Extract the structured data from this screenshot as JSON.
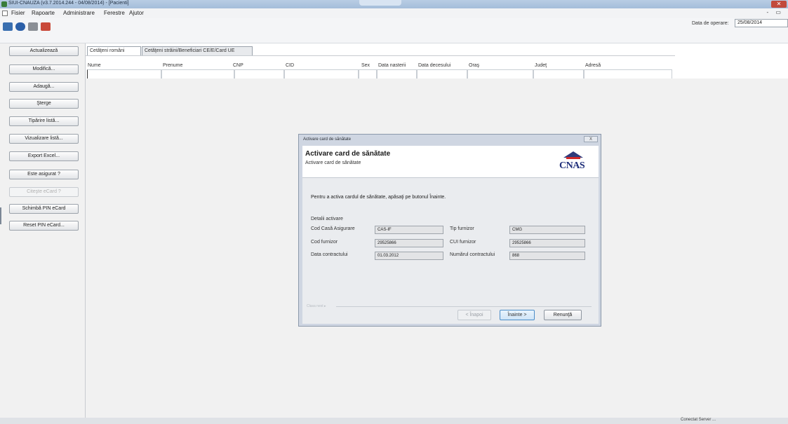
{
  "window": {
    "title": "SIUI-CNAUZA (v3.7.2014.244 - 04/08/2014) - [Pacienti]"
  },
  "menu": {
    "items": [
      "Fisier",
      "Rapoarte",
      "Administrare",
      "Ferestre",
      "Ajutor"
    ],
    "window_controls": "- ▭"
  },
  "toolbar": {
    "icons": [
      "people-icon",
      "card-icon",
      "printer-icon",
      "document-icon"
    ],
    "op_date_label": "Data de operare:",
    "op_date_value": "25/08/2014"
  },
  "sidebar": {
    "buttons": [
      {
        "label": "Actualizează",
        "enabled": true
      },
      {
        "label": "Modifică...",
        "enabled": true
      },
      {
        "label": "Adaugă...",
        "enabled": true
      },
      {
        "label": "Şterge",
        "enabled": true
      },
      {
        "label": "Tipărire listă...",
        "enabled": true
      },
      {
        "label": "Vizualizare listă...",
        "enabled": true
      },
      {
        "label": "Export Excel...",
        "enabled": true
      },
      {
        "label": "Este asigurat ?",
        "enabled": true
      },
      {
        "label": "Citeşte eCard ?",
        "enabled": false
      },
      {
        "label": "Schimbă PIN eCard",
        "enabled": true
      },
      {
        "label": "Reset PIN eCard...",
        "enabled": true
      }
    ]
  },
  "tabs": [
    {
      "label": "Cetăţeni români",
      "active": true
    },
    {
      "label": "Cetăţeni străini/Beneficiari CE/E/Card UE",
      "active": false
    }
  ],
  "grid": {
    "columns": [
      "Nume",
      "Prenume",
      "CNP",
      "CID",
      "Sex",
      "Data nasterii",
      "Data decesului",
      "Oraş",
      "Judeţ",
      "Adresă"
    ]
  },
  "status": {
    "text": "Conectat  Server  ..."
  },
  "dialog": {
    "window_title": "Activare card de sănătate",
    "close_label": "X",
    "header_title": "Activare card de sănătate",
    "header_subtitle": "Activare card de sănătate",
    "logo_text": "CNAS",
    "intro": "Pentru a activa cardul de sănătate, apăsaţi pe butonul Înainte.",
    "section_title": "Detalii activare",
    "fields": {
      "casa_label": "Cod Casă Asigurare",
      "casa_value": "CAS-IF",
      "tip_label": "Tip furnizor",
      "tip_value": "CMG",
      "cod_label": "Cod furnizor",
      "cod_value": "29525866",
      "cui_label": "CUI furnizor",
      "cui_value": "29525866",
      "data_label": "Data contractului",
      "data_value": "01.03.2012",
      "numar_label": "Numărul contractului",
      "numar_value": "868"
    },
    "step_label": "Clasa next ▸",
    "buttons": {
      "back": "< Înapoi",
      "next": "Înainte >",
      "cancel": "Renunţă"
    }
  }
}
